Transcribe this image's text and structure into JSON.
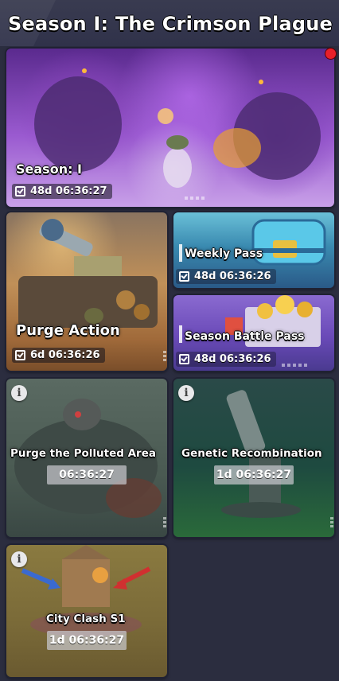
{
  "header": {
    "title": "Season I: The Crimson Plague"
  },
  "cards": {
    "season": {
      "title": "Season: I",
      "timer": "48d 06:36:27"
    },
    "purge_action": {
      "title": "Purge Action",
      "timer": "6d 06:36:26"
    },
    "weekly_pass": {
      "title": "Weekly Pass",
      "timer": "48d 06:36:26"
    },
    "season_battle_pass": {
      "title": "Season Battle Pass",
      "timer": "48d 06:36:26"
    },
    "purge_polluted": {
      "title": "Purge the Polluted Area",
      "timer": "06:36:27"
    },
    "genetic": {
      "title": "Genetic Recombination",
      "timer": "1d 06:36:27"
    },
    "city_clash": {
      "title": "City Clash S1",
      "timer": "1d 06:36:27"
    }
  },
  "icons": {
    "clock": "clock-icon",
    "info": "info-icon",
    "notification": "red-notification-dot"
  },
  "colors": {
    "background": "#2b2d3f",
    "notification": "#e8202a"
  }
}
